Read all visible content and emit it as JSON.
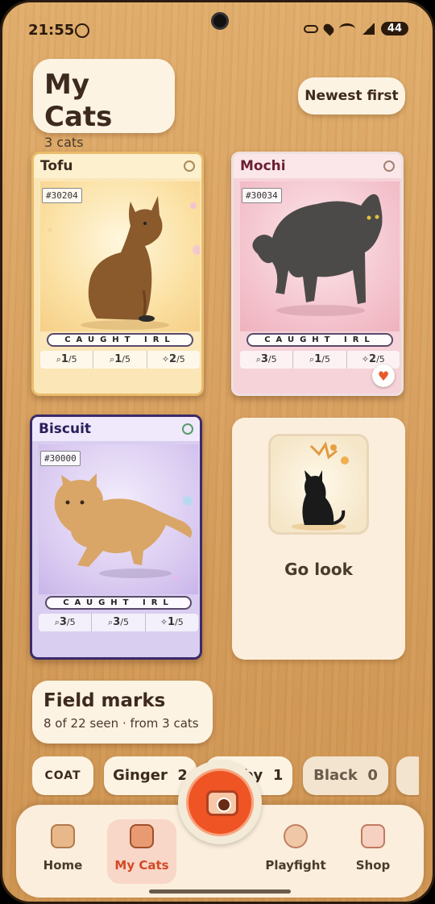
{
  "status_bar": {
    "time": "21:55",
    "battery": "44",
    "icons": [
      "ai-icon",
      "key-icon",
      "location-icon",
      "wifi-icon",
      "signal-icon"
    ]
  },
  "header": {
    "title": "My Cats",
    "count": "3 cats",
    "sort_label": "Newest first"
  },
  "cards": [
    {
      "name": "Tofu",
      "id": "#30204",
      "caught_label": "CAUGHT IRL",
      "stats": [
        {
          "icon": "paw-icon",
          "value": "1",
          "max": "/5"
        },
        {
          "icon": "paw-icon",
          "value": "1",
          "max": "/5"
        },
        {
          "icon": "sparkle-icon",
          "value": "2",
          "max": "/5"
        }
      ]
    },
    {
      "name": "Mochi",
      "id": "#30034",
      "caught_label": "CAUGHT IRL",
      "favorited": true,
      "stats": [
        {
          "icon": "paw-icon",
          "value": "3",
          "max": "/5"
        },
        {
          "icon": "paw-icon",
          "value": "1",
          "max": "/5"
        },
        {
          "icon": "sparkle-icon",
          "value": "2",
          "max": "/5"
        }
      ]
    },
    {
      "name": "Biscuit",
      "id": "#30000",
      "caught_label": "CAUGHT IRL",
      "stats": [
        {
          "icon": "paw-icon",
          "value": "3",
          "max": "/5"
        },
        {
          "icon": "paw-icon",
          "value": "3",
          "max": "/5"
        },
        {
          "icon": "sparkle-icon",
          "value": "1",
          "max": "/5"
        }
      ]
    }
  ],
  "go_look": {
    "label": "Go look"
  },
  "field_marks": {
    "title": "Field marks",
    "subtitle": "8 of 22 seen · from 3 cats"
  },
  "chips": [
    {
      "label": "COAT"
    },
    {
      "label": "Ginger",
      "count": "2"
    },
    {
      "label": "Tabby",
      "count": "1"
    },
    {
      "label": "Black",
      "count": "0"
    }
  ],
  "nav": {
    "items": [
      {
        "label": "Home"
      },
      {
        "label": "My Cats"
      },
      {
        "label": "Playfight"
      },
      {
        "label": "Shop"
      }
    ],
    "active": "My Cats"
  },
  "colors": {
    "accent": "#ee5424",
    "wood": "#d9a262",
    "cream": "#fdf3e3"
  }
}
